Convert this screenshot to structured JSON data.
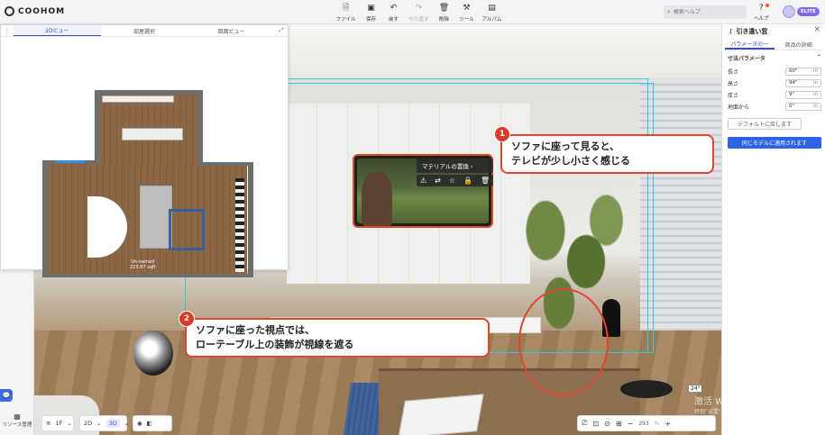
{
  "app": {
    "logo_text": "COOHOM"
  },
  "toolbar": [
    {
      "icon": "file-icon",
      "glyph": "🗎",
      "label": "ファイル",
      "disabled": false
    },
    {
      "icon": "save-icon",
      "glyph": "▣",
      "label": "保存",
      "disabled": false
    },
    {
      "icon": "undo-icon",
      "glyph": "↶",
      "label": "戻す",
      "disabled": false
    },
    {
      "icon": "redo-icon",
      "glyph": "↷",
      "label": "やり直す",
      "disabled": true
    },
    {
      "icon": "delete-icon",
      "glyph": "🗑",
      "label": "削除",
      "disabled": false
    },
    {
      "icon": "tools-icon",
      "glyph": "⚒",
      "label": "ツール",
      "disabled": false
    },
    {
      "icon": "album-icon",
      "glyph": "▤",
      "label": "アルバム",
      "disabled": false
    }
  ],
  "search": {
    "placeholder": "検索ヘルプ"
  },
  "help": {
    "label": "ヘルプ"
  },
  "user": {
    "badge": "ELITE"
  },
  "plan_panel": {
    "tabs": [
      "2Dビュー",
      "部屋選択",
      "図面ビュー"
    ],
    "active_tab": 0,
    "room_label_line1": "Un-named",
    "room_label_line2": "223.87 sqft"
  },
  "context_menu": {
    "replace_material": "マテリアルの置換"
  },
  "callouts": [
    {
      "number": "1",
      "line1": "ソファに座って見ると、",
      "line2": "テレビが少し小さく感じる"
    },
    {
      "number": "2",
      "line1": "ソファに座った視点では、",
      "line2": "ローテーブル上の装飾が視線を遮る"
    }
  ],
  "dimension_tag": "24\"",
  "watermark": {
    "line1": "激活 Windows",
    "line2": "转到\"设置\"以激活 Windows。"
  },
  "bottom_left": {
    "floor": "1F",
    "view2d": "2D",
    "view3d": "3D"
  },
  "bottom_right": {
    "zoom": "293"
  },
  "left_strip": {
    "resource_label": "リソース管理"
  },
  "right_panel": {
    "title": "引き違い窓",
    "tabs": [
      "パラメータの一",
      "商品の詳細"
    ],
    "active_tab": 0,
    "section": "寸法パラメータ",
    "params": [
      {
        "label": "長さ",
        "value": "60\"",
        "unit": "in"
      },
      {
        "label": "高さ",
        "value": "94\"",
        "unit": "in"
      },
      {
        "label": "厚さ",
        "value": "9\"",
        "unit": "in"
      },
      {
        "label": "地面から",
        "value": "0\"",
        "unit": "in"
      }
    ],
    "reset_button": "デフォルトに戻します",
    "apply_button": "同じモデルに適用されます"
  },
  "colors": {
    "accent": "#3a4bd6",
    "callout_red": "#e0452e",
    "selection_cyan": "#35c6e0",
    "primary_button": "#2d64e6"
  }
}
